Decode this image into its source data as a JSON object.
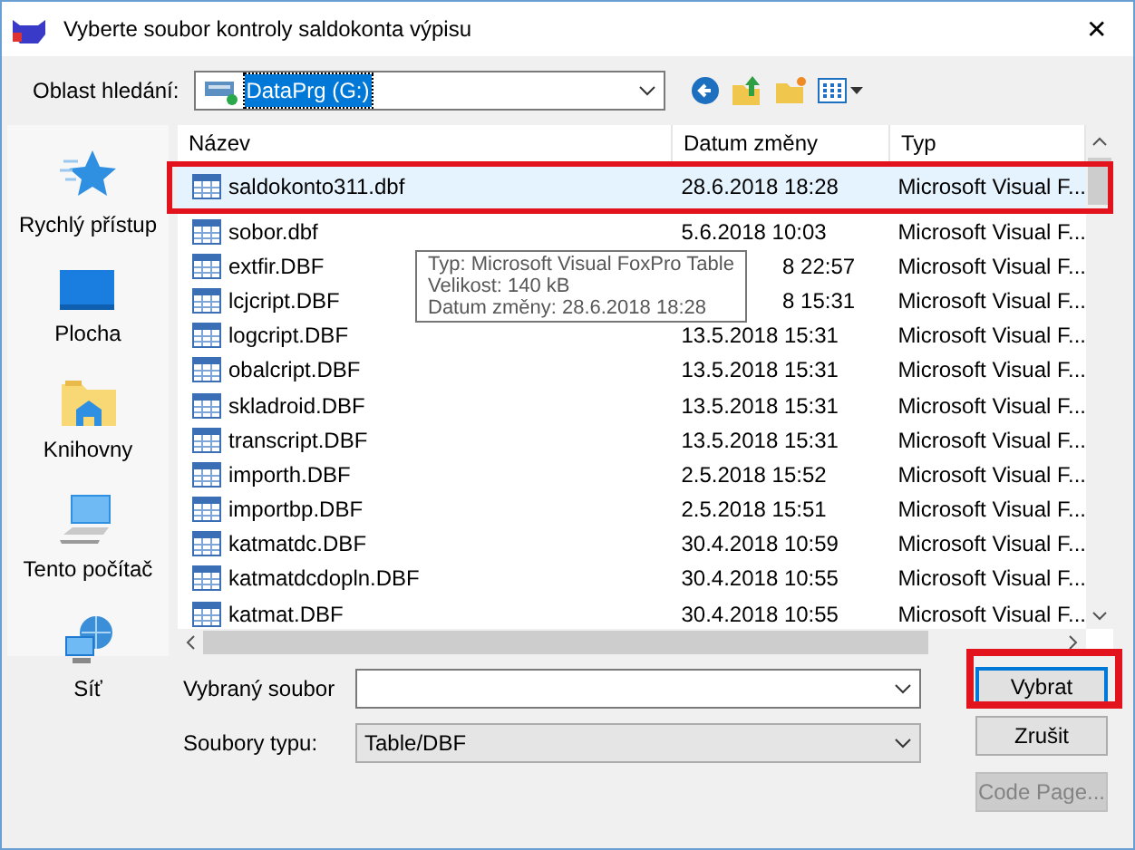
{
  "window": {
    "title": "Vyberte soubor kontroly saldokonta výpisu",
    "close": "✕"
  },
  "look_in": {
    "label": "Oblast hledání:",
    "value": "DataPrg (G:)"
  },
  "places": [
    {
      "label": "Rychlý přístup",
      "kind": "star"
    },
    {
      "label": "Plocha",
      "kind": "desktop"
    },
    {
      "label": "Knihovny",
      "kind": "library"
    },
    {
      "label": "Tento počítač",
      "kind": "computer"
    },
    {
      "label": "Síť",
      "kind": "network"
    }
  ],
  "table": {
    "columns": [
      "Název",
      "Datum změny",
      "Typ"
    ],
    "rows": [
      {
        "name": "saldokonto311.dbf",
        "date": "28.6.2018 18:28",
        "type": "Microsoft Visual F...",
        "selected": true,
        "under_tooltip": false
      },
      {
        "name": "sobor.dbf",
        "date": "5.6.2018 10:03",
        "type": "Microsoft Visual F...",
        "selected": false,
        "under_tooltip": false
      },
      {
        "name": "extfir.DBF",
        "date": "8 22:57",
        "type": "Microsoft Visual F...",
        "selected": false,
        "under_tooltip": true
      },
      {
        "name": "lcjcript.DBF",
        "date": "8 15:31",
        "type": "Microsoft Visual F...",
        "selected": false,
        "under_tooltip": true
      },
      {
        "name": "logcript.DBF",
        "date": "13.5.2018 15:31",
        "type": "Microsoft Visual F...",
        "selected": false,
        "under_tooltip": false
      },
      {
        "name": "obalcript.DBF",
        "date": "13.5.2018 15:31",
        "type": "Microsoft Visual F...",
        "selected": false,
        "under_tooltip": false
      },
      {
        "name": "skladroid.DBF",
        "date": "13.5.2018 15:31",
        "type": "Microsoft Visual F...",
        "selected": false,
        "under_tooltip": false
      },
      {
        "name": "transcript.DBF",
        "date": "13.5.2018 15:31",
        "type": "Microsoft Visual F...",
        "selected": false,
        "under_tooltip": false
      },
      {
        "name": "importh.DBF",
        "date": "2.5.2018 15:52",
        "type": "Microsoft Visual F...",
        "selected": false,
        "under_tooltip": false
      },
      {
        "name": "importbp.DBF",
        "date": "2.5.2018 15:51",
        "type": "Microsoft Visual F...",
        "selected": false,
        "under_tooltip": false
      },
      {
        "name": "katmatdc.DBF",
        "date": "30.4.2018 10:59",
        "type": "Microsoft Visual F...",
        "selected": false,
        "under_tooltip": false
      },
      {
        "name": "katmatdcdopln.DBF",
        "date": "30.4.2018 10:55",
        "type": "Microsoft Visual F...",
        "selected": false,
        "under_tooltip": false
      },
      {
        "name": "katmat.DBF",
        "date": "30.4.2018 10:55",
        "type": "Microsoft Visual F...",
        "selected": false,
        "under_tooltip": false
      }
    ]
  },
  "tooltip": [
    "Typ: Microsoft Visual FoxPro Table",
    "Velikost: 140 kB",
    "Datum změny: 28.6.2018 18:28"
  ],
  "file_name": {
    "label": "Vybraný soubor"
  },
  "file_type": {
    "label": "Soubory typu:",
    "value": "Table/DBF"
  },
  "buttons": [
    {
      "label": "Vybrat",
      "kind": "default",
      "disabled": false
    },
    {
      "label": "Zrušit",
      "kind": "normal",
      "disabled": false
    },
    {
      "label": "Code Page...",
      "kind": "normal",
      "disabled": true
    }
  ]
}
